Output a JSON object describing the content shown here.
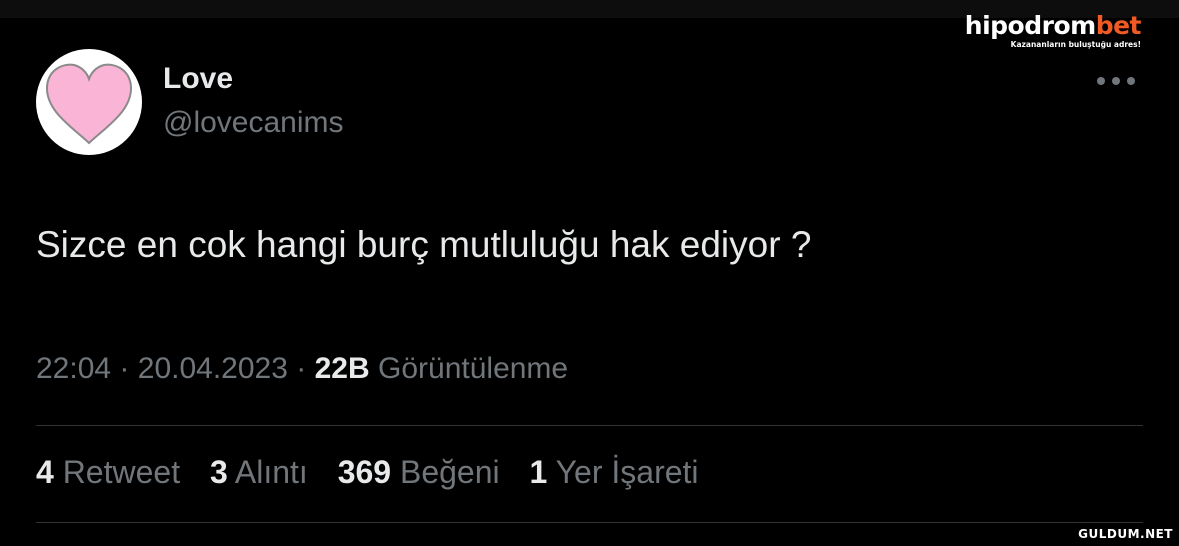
{
  "brand": {
    "name_main": "hipodrom",
    "name_accent": "bet",
    "tagline": "Kazananların buluştuğu adres!",
    "accent_color": "#f15a24"
  },
  "tweet": {
    "display_name": "Love",
    "handle": "@lovecanims",
    "avatar_icon": "pink-heart-icon",
    "more_icon": "more-options-icon",
    "text": "Sizce en cok hangi burç mutluluğu hak ediyor ?",
    "time": "22:04",
    "date": "20.04.2023",
    "views_count": "22B",
    "views_label": "Görüntülenme",
    "separator": "·"
  },
  "stats": {
    "retweets": {
      "count": "4",
      "label": "Retweet"
    },
    "quotes": {
      "count": "3",
      "label": "Alıntı"
    },
    "likes": {
      "count": "369",
      "label": "Beğeni"
    },
    "bookmarks": {
      "count": "1",
      "label": "Yer İşareti"
    }
  },
  "watermark": "GULDUM.NET",
  "colors": {
    "background": "#000000",
    "primary_text": "#e7e9ea",
    "secondary_text": "#71767b",
    "divider": "#2f3336",
    "heart_fill": "#f9b4d6"
  }
}
